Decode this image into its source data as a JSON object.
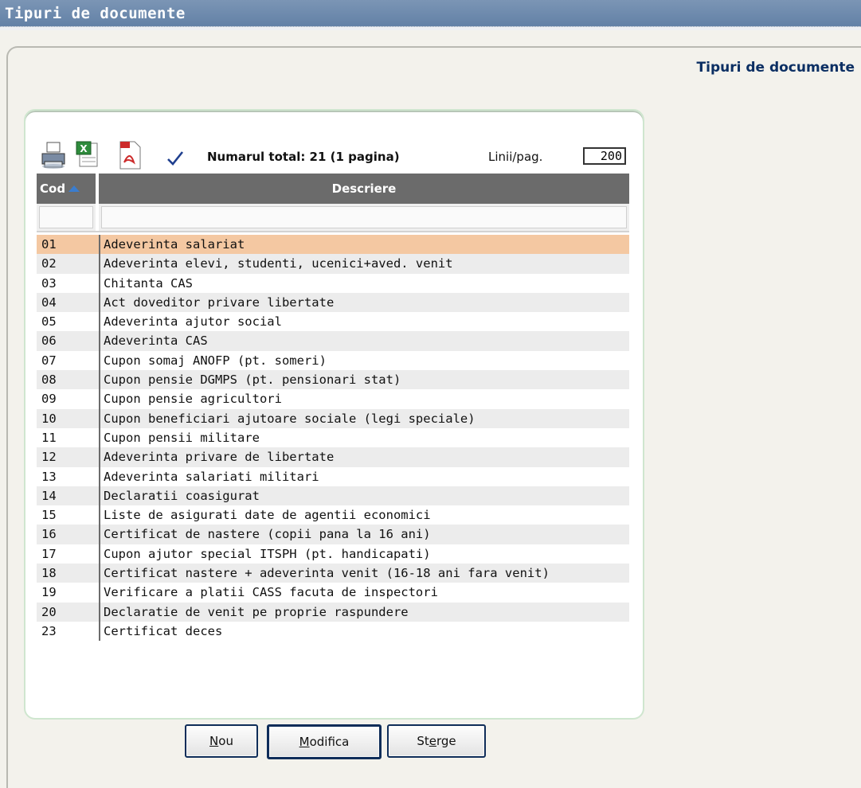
{
  "window": {
    "title": "Tipuri de documente"
  },
  "page": {
    "heading": "Tipuri de documente"
  },
  "toolbar": {
    "icons": [
      "printer-icon",
      "excel-icon",
      "pdf-icon",
      "checkmark-icon"
    ],
    "total": "Numarul total: 21 (1 pagina)",
    "rows_per_page_label": "Linii/pag.",
    "rows_per_page_value": "200"
  },
  "grid": {
    "columns": {
      "code": "Cod",
      "description": "Descriere"
    },
    "selected_index": 0,
    "rows": [
      {
        "code": "01",
        "description": "Adeverinta salariat"
      },
      {
        "code": "02",
        "description": "Adeverinta elevi, studenti, ucenici+aved. venit"
      },
      {
        "code": "03",
        "description": "Chitanta CAS"
      },
      {
        "code": "04",
        "description": "Act doveditor privare libertate"
      },
      {
        "code": "05",
        "description": "Adeverinta ajutor social"
      },
      {
        "code": "06",
        "description": "Adeverinta CAS"
      },
      {
        "code": "07",
        "description": "Cupon somaj ANOFP (pt. someri)"
      },
      {
        "code": "08",
        "description": "Cupon pensie DGMPS (pt. pensionari stat)"
      },
      {
        "code": "09",
        "description": "Cupon pensie agricultori"
      },
      {
        "code": "10",
        "description": "Cupon beneficiari ajutoare sociale (legi speciale)"
      },
      {
        "code": "11",
        "description": "Cupon pensii militare"
      },
      {
        "code": "12",
        "description": "Adeverinta privare de libertate"
      },
      {
        "code": "13",
        "description": "Adeverinta salariati militari"
      },
      {
        "code": "14",
        "description": "Declaratii coasigurat"
      },
      {
        "code": "15",
        "description": "Liste de asigurati date de agentii economici"
      },
      {
        "code": "16",
        "description": "Certificat de nastere (copii pana la 16 ani)"
      },
      {
        "code": "17",
        "description": "Cupon ajutor special ITSPH (pt. handicapati)"
      },
      {
        "code": "18",
        "description": "Certificat nastere + adeverinta venit (16-18 ani fara venit)"
      },
      {
        "code": "19",
        "description": "Verificare a platii CASS facuta de inspectori"
      },
      {
        "code": "20",
        "description": "Declaratie de venit pe proprie raspundere"
      },
      {
        "code": "23",
        "description": "Certificat deces"
      }
    ]
  },
  "buttons": {
    "nou": {
      "pre": "",
      "key": "N",
      "post": "ou"
    },
    "modifica": {
      "pre": "",
      "key": "M",
      "post": "odifica"
    },
    "sterge": {
      "pre": "St",
      "key": "e",
      "post": "rge"
    }
  }
}
